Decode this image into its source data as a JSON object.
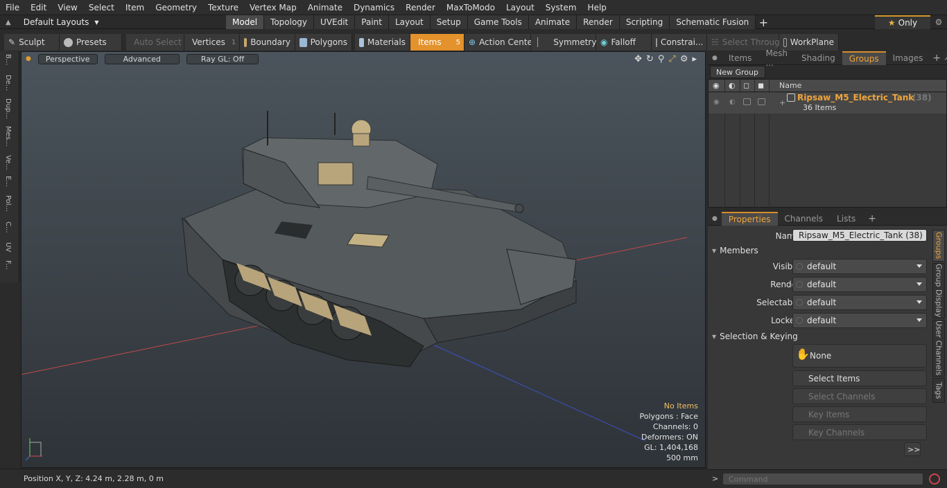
{
  "menu": [
    "File",
    "Edit",
    "View",
    "Select",
    "Item",
    "Geometry",
    "Texture",
    "Vertex Map",
    "Animate",
    "Dynamics",
    "Render",
    "MaxToModo",
    "Layout",
    "System",
    "Help"
  ],
  "layouts_label": "Default Layouts",
  "mode_tabs": [
    "Model",
    "Topology",
    "UVEdit",
    "Paint",
    "Layout",
    "Setup",
    "Game Tools",
    "Animate",
    "Render",
    "Scripting",
    "Schematic Fusion"
  ],
  "only_label": "Only",
  "toolbar": {
    "sculpt": "Sculpt",
    "presets": "Presets",
    "auto_select": "Auto Select",
    "vertices": "Vertices",
    "vertices_n": "1",
    "boundary": "Boundary",
    "polygons": "Polygons",
    "materials": "Materials",
    "items": "Items",
    "items_n": "5",
    "action_center": "Action Center",
    "symmetry": "Symmetry",
    "falloff": "Falloff",
    "constraints": "Constrai...",
    "select_through": "Select Through",
    "workplane": "WorkPlane"
  },
  "left_tabs": [
    "B...",
    "De...",
    "Dup...",
    "Mes...",
    "Ve...",
    "E...",
    "Pol...",
    "C...",
    "UV",
    "F..."
  ],
  "viewport": {
    "perspective": "Perspective",
    "advanced": "Advanced",
    "raygl": "Ray GL: Off",
    "info": {
      "no_items": "No Items",
      "polygons": "Polygons : Face",
      "channels": "Channels: 0",
      "deformers": "Deformers: ON",
      "gl": "GL: 1,404,168",
      "scale": "500 mm"
    }
  },
  "status": {
    "position": "Position X, Y, Z:   4.24 m, 2.28 m, 0 m"
  },
  "top_tabs": [
    "Items",
    "Mesh ...",
    "Shading",
    "Groups",
    "Images"
  ],
  "groups": {
    "new_group": "New Group",
    "col_name": "Name",
    "item_name": "Ripsaw_M5_Electric_Tank",
    "item_count": "(38)",
    "item_sub": "36 Items"
  },
  "prop_tabs": [
    "Properties",
    "Channels",
    "Lists"
  ],
  "properties": {
    "name_label": "Name",
    "name_value": "Ripsaw_M5_Electric_Tank (38)",
    "members": "Members",
    "visible_label": "Visible",
    "visible_value": "default",
    "render_label": "Render",
    "render_value": "default",
    "selectable_label": "Selectable",
    "selectable_value": "default",
    "locked_label": "Locked",
    "locked_value": "default",
    "sel_keying": "Selection & Keying",
    "none": "None",
    "select_items": "Select Items",
    "select_channels": "Select Channels",
    "key_items": "Key Items",
    "key_channels": "Key Channels",
    "more": ">>"
  },
  "side_tabs": [
    "Groups",
    "Group Display",
    "User Channels",
    "Tags"
  ],
  "command_placeholder": "Command"
}
